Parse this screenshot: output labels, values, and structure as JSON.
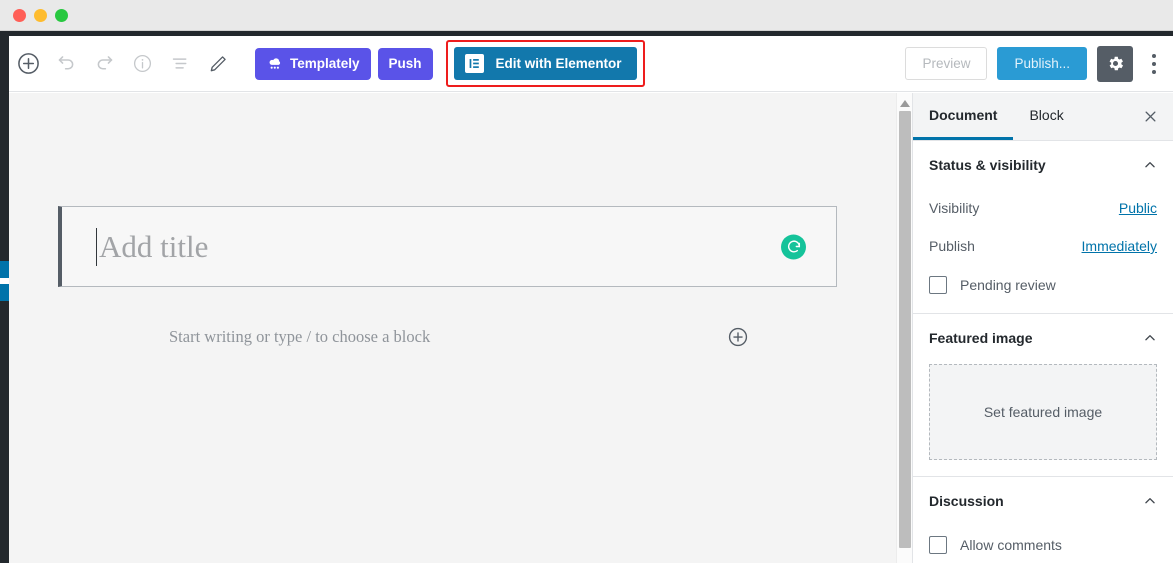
{
  "window": {
    "traffic_lights": [
      "close",
      "minimize",
      "maximize"
    ],
    "colors": {
      "close": "#ff5f57",
      "minimize": "#febc2e",
      "maximize": "#28c840"
    }
  },
  "toolbar": {
    "icons": [
      {
        "name": "add-block-icon",
        "label": "Add block"
      },
      {
        "name": "undo-icon",
        "label": "Undo"
      },
      {
        "name": "redo-icon",
        "label": "Redo"
      },
      {
        "name": "content-info-icon",
        "label": "Content structure"
      },
      {
        "name": "list-view-icon",
        "label": "Block navigation"
      },
      {
        "name": "edit-pencil-icon",
        "label": "Edit"
      }
    ],
    "templately_label": "Templately",
    "push_label": "Push",
    "elementor_label": "Edit with Elementor",
    "preview_label": "Preview",
    "publish_label": "Publish...",
    "settings_label": "Settings",
    "more_label": "More tools & options",
    "accent_purple": "#5a53e8",
    "accent_elementor_blue": "#1278ac",
    "accent_publish_blue": "#2a9bd4",
    "highlight_outline": "#ee1d1d"
  },
  "editor": {
    "title_placeholder": "Add title",
    "paragraph_placeholder": "Start writing or type / to choose a block",
    "grammarly_label": "G",
    "grammarly_color": "#15c39a",
    "inserter_label": "Add block"
  },
  "sidebar": {
    "tabs": [
      {
        "label": "Document",
        "active": true
      },
      {
        "label": "Block",
        "active": false
      }
    ],
    "close_label": "Close settings",
    "panels": [
      {
        "title": "Status & visibility",
        "rows": [
          {
            "label": "Visibility",
            "value": "Public"
          },
          {
            "label": "Publish",
            "value": "Immediately"
          }
        ],
        "checkbox": "Pending review"
      },
      {
        "title": "Featured image",
        "placeholder": "Set featured image"
      },
      {
        "title": "Discussion",
        "checkbox": "Allow comments"
      }
    ],
    "link_color": "#0073aa"
  }
}
